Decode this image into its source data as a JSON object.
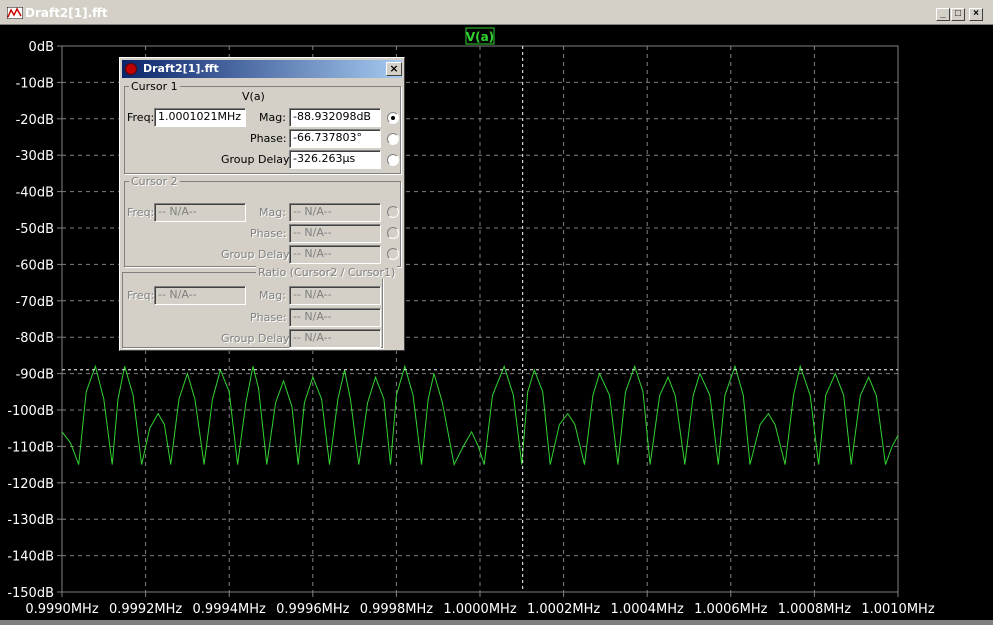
{
  "window": {
    "title": "Draft2[1].fft",
    "minimize": "_",
    "maximize": "□",
    "close": "×"
  },
  "trace_label": "V(a)",
  "colors": {
    "trace": "#32d232",
    "background": "#000000",
    "grid": "#808080",
    "cursor": "#ffffff"
  },
  "chart_data": {
    "type": "line",
    "series": [
      {
        "name": "V(a)",
        "x": [
          0.999,
          0.99902,
          0.99904,
          0.999058,
          0.99908,
          0.9991,
          0.99912,
          0.999134,
          0.99915,
          0.99917,
          0.9991904,
          0.99921,
          0.99923,
          0.999245,
          0.99926,
          0.99928,
          0.9993,
          0.999318,
          0.99934,
          0.99936,
          0.999379,
          0.9994,
          0.99942,
          0.99944,
          0.999457,
          0.99947,
          0.99949,
          0.999511,
          0.99953,
          0.99955,
          0.999565,
          0.99958,
          0.9996,
          0.999621,
          0.99964,
          0.99966,
          0.999676,
          0.99969,
          0.99971,
          0.999731,
          0.99975,
          0.99977,
          0.999786,
          0.9998,
          0.99982,
          0.99984,
          0.99986,
          0.999876,
          0.99989,
          0.99991,
          0.999938,
          0.99996,
          0.99998,
          0.999996,
          1.00001,
          1.00003,
          1.000058,
          1.00008,
          1.0001,
          1.000114,
          1.00013,
          1.00015,
          1.000168,
          1.00019,
          1.00021,
          1.000227,
          1.00025,
          1.00027,
          1.000286,
          1.00031,
          1.00033,
          1.000348,
          1.00037,
          1.00039,
          1.000407,
          1.00043,
          1.00045,
          1.000467,
          1.00049,
          1.00051,
          1.000526,
          1.00055,
          1.00057,
          1.000586,
          1.00061,
          1.00063,
          1.000646,
          1.00067,
          1.00069,
          1.000706,
          1.00073,
          1.00075,
          1.000766,
          1.00079,
          1.00081,
          1.000827,
          1.00085,
          1.00087,
          1.000888,
          1.00091,
          1.00093,
          1.000948,
          1.00097,
          1.000986,
          1.001
        ],
        "y": [
          -106,
          -109,
          -115,
          -95,
          -88,
          -97,
          -115,
          -97,
          -88,
          -96,
          -115,
          -105,
          -101,
          -104,
          -115,
          -97,
          -90,
          -97,
          -115,
          -97,
          -89,
          -95,
          -115,
          -98,
          -88,
          -94,
          -115,
          -98,
          -92,
          -99,
          -115,
          -98,
          -91,
          -97,
          -115,
          -97,
          -89,
          -97,
          -115,
          -98,
          -91,
          -97,
          -115,
          -96,
          -88,
          -96,
          -115,
          -97,
          -90,
          -98,
          -115,
          -110,
          -106,
          -110,
          -115,
          -96,
          -88,
          -96,
          -115,
          -95,
          -89,
          -95,
          -115,
          -104,
          -101,
          -104,
          -115,
          -96,
          -90,
          -96,
          -115,
          -95,
          -88,
          -95,
          -115,
          -96,
          -91,
          -96,
          -115,
          -96,
          -90,
          -96,
          -115,
          -96,
          -88,
          -96,
          -115,
          -104,
          -101,
          -104,
          -115,
          -96,
          -88,
          -96,
          -115,
          -96,
          -90,
          -96,
          -115,
          -96,
          -91,
          -96,
          -115,
          -110,
          -107
        ]
      }
    ],
    "xlim": [
      0.999,
      1.001
    ],
    "ylim": [
      -150,
      0
    ],
    "x_ticks": [
      "0.9990MHz",
      "0.9992MHz",
      "0.9994MHz",
      "0.9996MHz",
      "0.9998MHz",
      "1.0000MHz",
      "1.0002MHz",
      "1.0004MHz",
      "1.0006MHz",
      "1.0008MHz",
      "1.0010MHz"
    ],
    "y_ticks": [
      "0dB",
      "-10dB",
      "-20dB",
      "-30dB",
      "-40dB",
      "-50dB",
      "-60dB",
      "-70dB",
      "-80dB",
      "-90dB",
      "-100dB",
      "-110dB",
      "-120dB",
      "-130dB",
      "-140dB",
      "-150dB"
    ],
    "grid": true,
    "cursor": {
      "x": 1.0001021,
      "y": -88.932098
    }
  },
  "dialog": {
    "title": "Draft2[1].fft",
    "close": "×",
    "cursor1": {
      "legend": "Cursor 1",
      "trace": "V(a)",
      "freq_label": "Freq:",
      "freq": "1.0001021MHz",
      "mag_label": "Mag:",
      "mag": "-88.932098dB",
      "phase_label": "Phase:",
      "phase": "-66.737803°",
      "gd_label": "Group Delay:",
      "gd": "-326.263µs"
    },
    "cursor2": {
      "legend": "Cursor 2",
      "freq_label": "Freq:",
      "freq": "-- N/A--",
      "mag_label": "Mag:",
      "mag": "-- N/A--",
      "phase_label": "Phase:",
      "phase": "-- N/A--",
      "gd_label": "Group Delay:",
      "gd": "-- N/A--"
    },
    "ratio": {
      "legend": "Ratio (Cursor2 / Cursor1)",
      "freq_label": "Freq:",
      "freq": "-- N/A--",
      "mag_label": "Mag:",
      "mag": "-- N/A--",
      "phase_label": "Phase:",
      "phase": "-- N/A--",
      "gd_label": "Group Delay:",
      "gd": "-- N/A--"
    }
  }
}
